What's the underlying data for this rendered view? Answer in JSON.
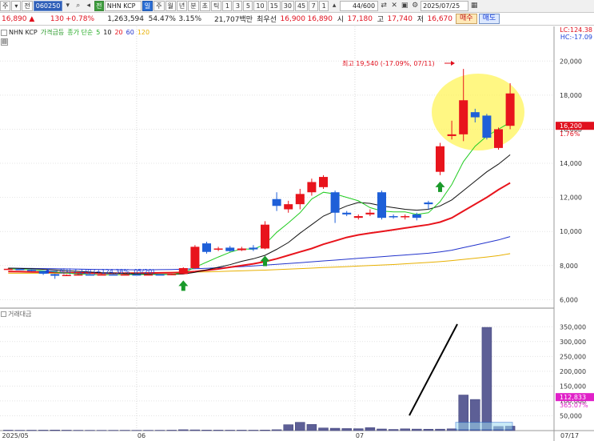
{
  "toolbar": {
    "items": [
      "주",
      "▾",
      "전"
    ],
    "code": "060250",
    "jeon": "전",
    "name": "NHN KCP",
    "periods": [
      "일",
      "주",
      "월",
      "년",
      "분",
      "초",
      "틱"
    ],
    "intervals": [
      "1",
      "3",
      "5",
      "10",
      "15",
      "30",
      "45",
      "7",
      "1"
    ],
    "count": "44/600",
    "date": "2025/07/25"
  },
  "quote": {
    "price": "16,890 ▲",
    "change": "130",
    "change_pct": "+0.78%",
    "volume": "1,263,594",
    "ratio1": "54.47%",
    "ratio2": "3.15%",
    "amount": "21,707백만",
    "best_ask_label": "최우선",
    "best_ask": "16,900",
    "best_bid": "16,890",
    "open_label": "시",
    "open": "17,180",
    "high_label": "고",
    "high": "17,740",
    "low_label": "저",
    "low": "16,670",
    "buy": "매수",
    "sell": "매도"
  },
  "legend": {
    "name": "NHN KCP",
    "indicator": "가격급등",
    "ma_label": "종가 단순",
    "ma": [
      "5",
      "10",
      "20",
      "60",
      "120"
    ]
  },
  "badges": {
    "lc": "LC:124.38",
    "hc": "HC:-17.09",
    "price_tag": "16,200",
    "price_pct": "1.76%",
    "vol_tag": "112,833",
    "vol_pct": "365.07%"
  },
  "annotations": {
    "high": "최고 19,540 (-17.09%, 07/11)",
    "low": "최저 7,220 (+124.38%, 05/20)"
  },
  "vol_legend": "거래대금",
  "colors": {
    "up": "#e8141c",
    "down": "#1e5fd8",
    "ma5": "#22cc22",
    "ma10": "#111111",
    "ma20": "#e8141c",
    "ma60": "#2233cc",
    "ma120": "#e8b000",
    "highlight": "#fff45a"
  },
  "chart_data": {
    "type": "candlestick",
    "x_ticks": [
      "2025/05",
      "06",
      "07",
      "07/17"
    ],
    "y_ticks": [
      "20,000",
      "18,000",
      "16,000",
      "14,000",
      "12,000",
      "10,000",
      "8,000",
      "6,000"
    ],
    "ylim": [
      5500,
      21000
    ],
    "vol_ticks": [
      "350,000",
      "300,000",
      "250,000",
      "200,000",
      "150,000",
      "100,000",
      "50,000"
    ],
    "vol_ylim": [
      0,
      375000
    ],
    "candles": [
      [
        7800,
        7810,
        7850,
        7780
      ],
      [
        7800,
        7780,
        7820,
        7760
      ],
      [
        7760,
        7680,
        7780,
        7660
      ],
      [
        7680,
        7520,
        7700,
        7450
      ],
      [
        7500,
        7400,
        7520,
        7220
      ],
      [
        7400,
        7450,
        7480,
        7380
      ],
      [
        7450,
        7480,
        7520,
        7420
      ],
      [
        7480,
        7470,
        7500,
        7440
      ],
      [
        7470,
        7480,
        7500,
        7450
      ],
      [
        7480,
        7470,
        7500,
        7450
      ],
      [
        7470,
        7480,
        7510,
        7460
      ],
      [
        7480,
        7470,
        7500,
        7450
      ],
      [
        7470,
        7480,
        7500,
        7460
      ],
      [
        7480,
        7470,
        7500,
        7450
      ],
      [
        7470,
        7500,
        7520,
        7460
      ],
      [
        7500,
        7850,
        7900,
        7500
      ],
      [
        7850,
        9100,
        9200,
        7800
      ],
      [
        9300,
        8800,
        9400,
        8700
      ],
      [
        8950,
        9000,
        9100,
        8850
      ],
      [
        9050,
        8850,
        9150,
        8800
      ],
      [
        8900,
        9000,
        9100,
        8850
      ],
      [
        9050,
        8950,
        9200,
        8850
      ],
      [
        9000,
        10400,
        10600,
        8950
      ],
      [
        11900,
        11500,
        12300,
        11200
      ],
      [
        11300,
        11600,
        11800,
        11100
      ],
      [
        11600,
        12200,
        12500,
        11300
      ],
      [
        12300,
        12900,
        13100,
        12100
      ],
      [
        12600,
        13200,
        13300,
        12500
      ],
      [
        12300,
        11100,
        12400,
        10500
      ],
      [
        11100,
        11000,
        11200,
        10900
      ],
      [
        10800,
        10900,
        11000,
        10700
      ],
      [
        11000,
        11100,
        11300,
        10900
      ],
      [
        12300,
        10800,
        12400,
        10700
      ],
      [
        10900,
        10850,
        11000,
        10750
      ],
      [
        10850,
        10900,
        11000,
        10700
      ],
      [
        11000,
        10800,
        11100,
        10650
      ],
      [
        11700,
        11600,
        11800,
        11300
      ],
      [
        13500,
        15000,
        15200,
        13300
      ],
      [
        15600,
        15700,
        16500,
        15400
      ],
      [
        15700,
        17700,
        19540,
        15300
      ],
      [
        17000,
        16700,
        17200,
        16400
      ],
      [
        16800,
        15500,
        16900,
        15400
      ],
      [
        14900,
        16000,
        16100,
        14800
      ],
      [
        16200,
        18100,
        18700,
        16000
      ]
    ],
    "volumes": [
      1500,
      1200,
      1400,
      1600,
      2000,
      1500,
      1200,
      1100,
      1000,
      1100,
      1200,
      1000,
      1100,
      1200,
      1500,
      3000,
      2500,
      1800,
      1700,
      1500,
      1600,
      1500,
      2000,
      3000,
      20000,
      28000,
      21000,
      9000,
      8000,
      7000,
      6500,
      10000,
      5500,
      4000,
      6000,
      5200,
      4800,
      5000,
      6000,
      120000,
      105000,
      348000,
      14000,
      15000,
      13000,
      15000,
      60000
    ],
    "signals_up": [
      15,
      22,
      37
    ],
    "ma5": [
      7800,
      7780,
      7750,
      7690,
      7620,
      7560,
      7510,
      7470,
      7460,
      7465,
      7470,
      7475,
      7475,
      7475,
      7480,
      7560,
      7900,
      8200,
      8500,
      8780,
      8980,
      8950,
      9250,
      9950,
      10500,
      11100,
      11900,
      12300,
      12200,
      12000,
      11800,
      11400,
      11200,
      11150,
      11150,
      11000,
      11100,
      11750,
      12750,
      14100,
      15000,
      15600,
      16000,
      16400
    ],
    "ma10": [
      7850,
      7830,
      7810,
      7780,
      7740,
      7700,
      7660,
      7620,
      7580,
      7560,
      7530,
      7510,
      7495,
      7485,
      7480,
      7500,
      7600,
      7750,
      7900,
      8050,
      8250,
      8400,
      8600,
      8950,
      9350,
      9900,
      10400,
      10900,
      11200,
      11500,
      11700,
      11650,
      11500,
      11400,
      11300,
      11250,
      11300,
      11500,
      11850,
      12400,
      12950,
      13500,
      13950,
      14500
    ],
    "ma20": [
      7650,
      7640,
      7630,
      7620,
      7600,
      7580,
      7570,
      7560,
      7550,
      7550,
      7550,
      7550,
      7560,
      7570,
      7580,
      7600,
      7650,
      7720,
      7800,
      7900,
      8000,
      8100,
      8230,
      8400,
      8600,
      8800,
      9000,
      9250,
      9450,
      9650,
      9800,
      9900,
      10000,
      10100,
      10200,
      10300,
      10400,
      10550,
      10800,
      11200,
      11600,
      12000,
      12450,
      12850
    ],
    "ma60": [
      7850,
      7840,
      7830,
      7820,
      7810,
      7800,
      7790,
      7780,
      7770,
      7760,
      7755,
      7750,
      7750,
      7760,
      7770,
      7790,
      7810,
      7840,
      7870,
      7900,
      7940,
      7980,
      8020,
      8070,
      8120,
      8170,
      8220,
      8270,
      8320,
      8370,
      8420,
      8470,
      8520,
      8570,
      8620,
      8670,
      8720,
      8800,
      8900,
      9050,
      9200,
      9350,
      9500,
      9700
    ],
    "ma120": [
      7550,
      7550,
      7550,
      7550,
      7550,
      7550,
      7550,
      7555,
      7560,
      7565,
      7570,
      7575,
      7580,
      7590,
      7600,
      7610,
      7620,
      7630,
      7650,
      7670,
      7690,
      7710,
      7730,
      7760,
      7790,
      7820,
      7850,
      7880,
      7910,
      7940,
      7970,
      8000,
      8030,
      8060,
      8100,
      8140,
      8180,
      8230,
      8290,
      8360,
      8430,
      8500,
      8580,
      8700
    ]
  }
}
